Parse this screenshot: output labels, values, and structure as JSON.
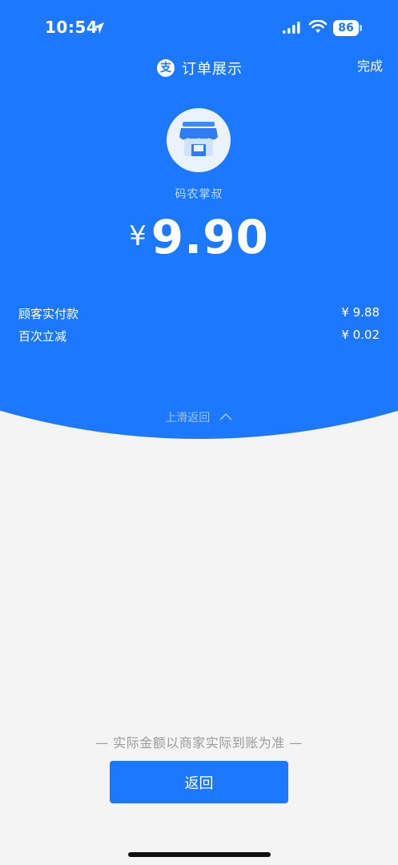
{
  "status_bar": {
    "time": "10:54",
    "battery": "86",
    "icons": [
      "location-arrow-icon",
      "signal-icon",
      "wifi-icon",
      "battery-icon"
    ]
  },
  "nav": {
    "logo_glyph": "支",
    "title": "订单展示",
    "done_label": "完成"
  },
  "merchant": {
    "name": "码农掌叔",
    "icon": "shop-icon"
  },
  "payment": {
    "currency": "¥",
    "amount": "9.90"
  },
  "details": [
    {
      "label": "顾客实付款",
      "value": "¥ 9.88"
    },
    {
      "label": "百次立减",
      "value": "¥ 0.02"
    }
  ],
  "swipe_hint": "上滑返回",
  "notice": "— 实际金额以商家实际到账为准 —",
  "back_button_label": "返回",
  "colors": {
    "primary_blue": "#1c78ff",
    "background": "#f4f4f4",
    "notice_text": "#9a9a9a"
  }
}
